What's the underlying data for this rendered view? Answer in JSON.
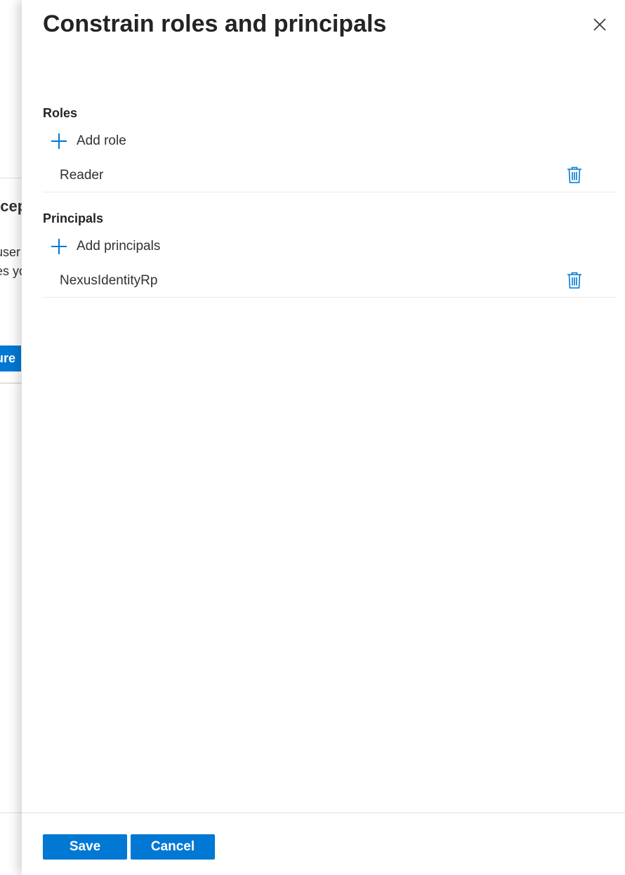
{
  "background": {
    "heading_fragment": "xcep",
    "text_line_1": "user",
    "text_line_2": "es yo",
    "button_fragment": "ure"
  },
  "panel": {
    "title": "Constrain roles and principals",
    "close_icon": "close-icon"
  },
  "roles": {
    "label": "Roles",
    "add_label": "Add role",
    "items": [
      {
        "name": "Reader"
      }
    ]
  },
  "principals": {
    "label": "Principals",
    "add_label": "Add principals",
    "items": [
      {
        "name": "NexusIdentityRp"
      }
    ]
  },
  "footer": {
    "save_label": "Save",
    "cancel_label": "Cancel"
  },
  "colors": {
    "accent": "#0078d4",
    "text": "#323130",
    "divider": "#edebe9"
  }
}
